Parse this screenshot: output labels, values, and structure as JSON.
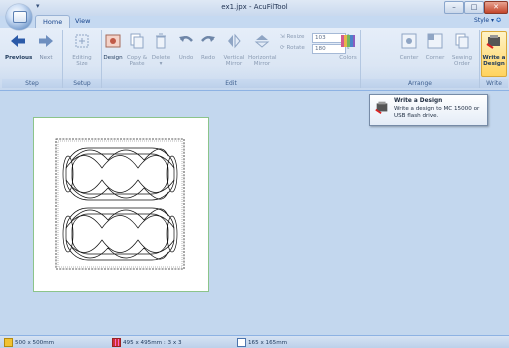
{
  "window": {
    "title": "ex1.jpx - AcuFilTool",
    "minimize_label": "–",
    "maximize_label": "□",
    "close_label": "✕",
    "qat_label": "▾"
  },
  "tabs": [
    {
      "label": "Home",
      "active": true
    },
    {
      "label": "View",
      "active": false
    }
  ],
  "style_menu": "Style ▾",
  "ribbon": {
    "groups": {
      "step": "Step",
      "setup": "Setup",
      "edit": "Edit",
      "arrange": "Arrange",
      "write": "Write"
    },
    "buttons": {
      "previous": "Previous",
      "next": "Next",
      "editing_size": "Editing\nSize",
      "design": "Design",
      "copy_paste": "Copy &\nPaste",
      "delete": "Delete\n▾",
      "undo": "Undo",
      "redo": "Redo",
      "vertical_mirror": "Vertical\nMirror",
      "horizontal_mirror": "Horizontal\nMirror",
      "colors": "Colors",
      "center": "Center",
      "corner": "Corner",
      "sewing_order": "Sewing\nOrder",
      "write_design": "Write a\nDesign"
    },
    "resize": {
      "label": "Resize",
      "value": "103"
    },
    "rotate": {
      "label": "Rotate",
      "value": "180"
    }
  },
  "tooltip": {
    "title": "Write a Design",
    "text": "Write a design to MC 15000 or USB flash drive."
  },
  "status": {
    "hoop": "500 x 500mm",
    "grid": "495 x 495mm : 3 x 3",
    "design": "165 x 165mm"
  },
  "colors": {
    "accent": "#15428b",
    "workspace": "#c3d7ee",
    "page_border": "#8cc48a"
  }
}
